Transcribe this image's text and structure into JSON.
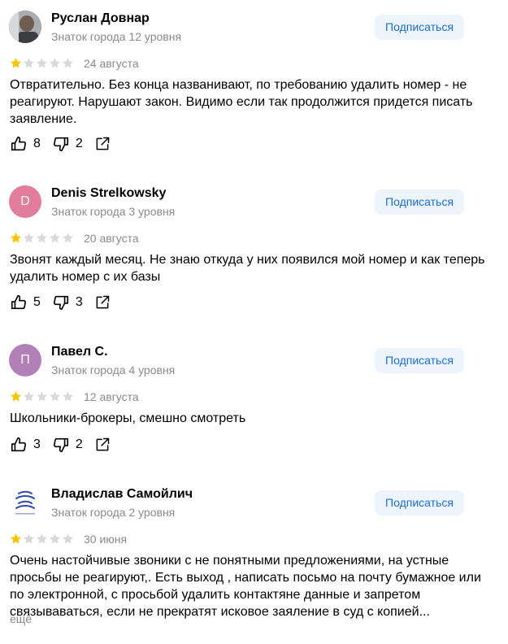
{
  "reviews": [
    {
      "name": "Руслан Довнар",
      "level": "Знаток города 12 уровня",
      "subscribe_label": "Подписаться",
      "rating": 1,
      "date": "24 августа",
      "text": "Отвратительно. Без конца названивают, по требованию удалить номер - не реагируют. Нарушают закон. Видимо если так продолжится придется писать заявление.",
      "likes": "8",
      "dislikes": "2",
      "avatar": {
        "type": "photo",
        "letter": "",
        "color": "#6b6f73"
      }
    },
    {
      "name": "Denis Strelkowsky",
      "level": "Знаток города 3 уровня",
      "subscribe_label": "Подписаться",
      "rating": 1,
      "date": "20 августа",
      "text": "Звонят каждый месяц. Не знаю откуда у них появился мой номер и как теперь удалить номер с их базы",
      "likes": "5",
      "dislikes": "3",
      "avatar": {
        "type": "letter",
        "letter": "D",
        "color": "#e27d9e"
      }
    },
    {
      "name": "Павел С.",
      "level": "Знаток города 4 уровня",
      "subscribe_label": "Подписаться",
      "rating": 1,
      "date": "12 августа",
      "text": "Школьники-брокеры, смешно смотреть",
      "likes": "3",
      "dislikes": "2",
      "avatar": {
        "type": "letter",
        "letter": "П",
        "color": "#b27fb8"
      }
    },
    {
      "name": "Владислав Самойлич",
      "level": "Знаток города 2 уровня",
      "subscribe_label": "Подписаться",
      "rating": 1,
      "date": "30 июня",
      "text": "Очень настойчивые звоники с не понятными предложениями, на устные просьбы не реагируют,. Есть выход , написать посьмо на почту бумажное или по электронной, с просьбой удалить контактяне данные и запретом связываваться, если не прекратят исковое заяление в суд с копией...",
      "likes": "",
      "dislikes": "",
      "avatar": {
        "type": "logo",
        "letter": "",
        "color": "#ffffff"
      }
    }
  ],
  "more_label": "ещё",
  "colors": {
    "star_filled": "#fcc400",
    "star_empty": "#d9d9d9",
    "subscribe_bg": "#eef4fb",
    "subscribe_text": "#1a6fd8",
    "muted_text": "#8a8a8a"
  }
}
